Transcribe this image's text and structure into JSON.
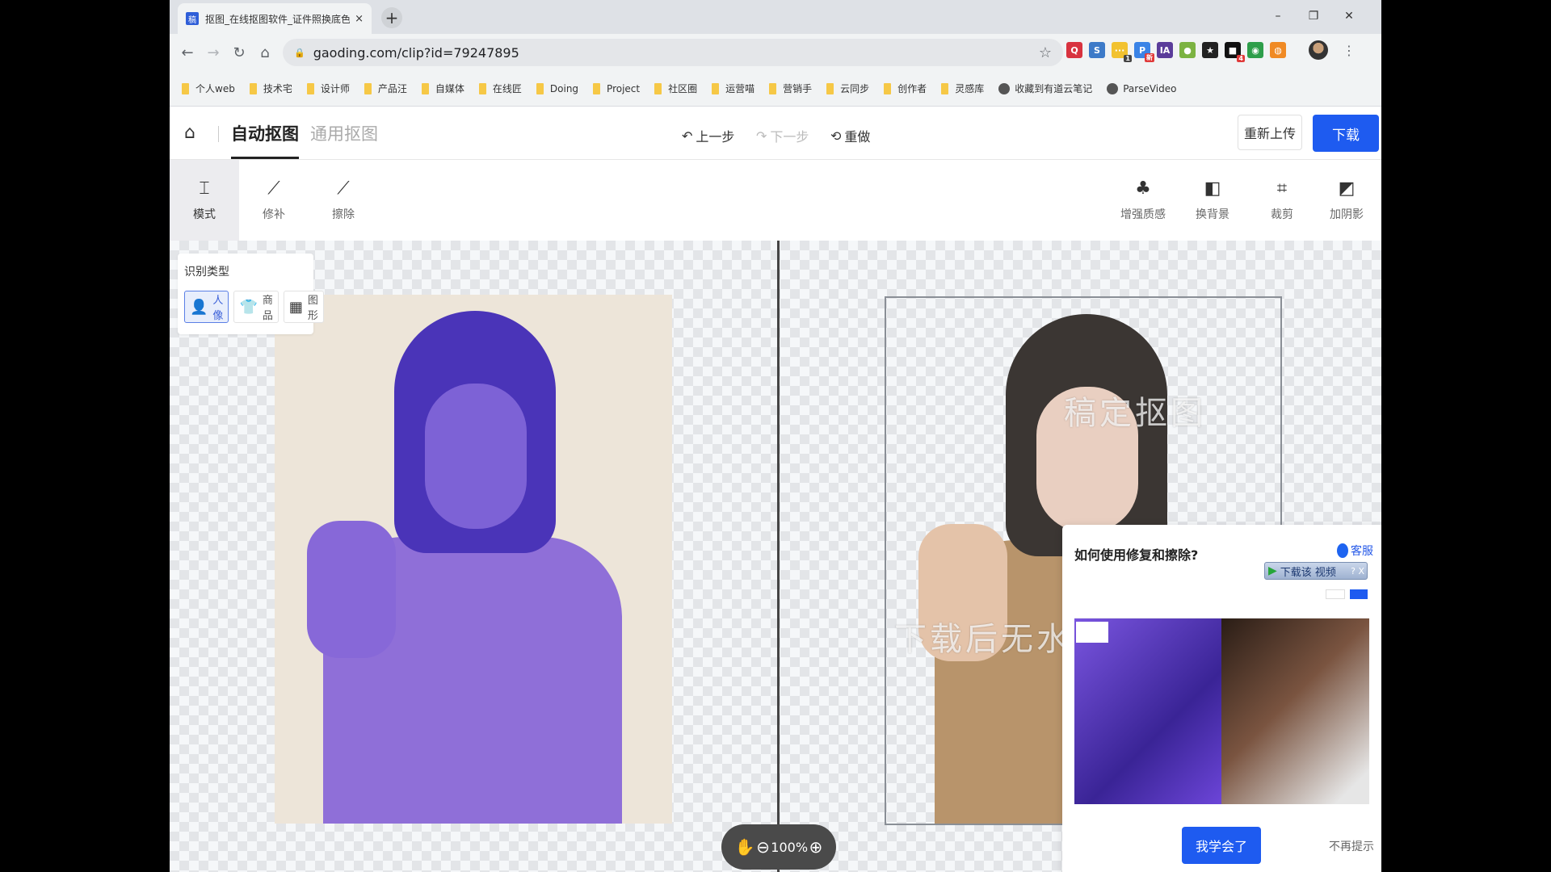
{
  "browser": {
    "tab": {
      "favicon": "稿",
      "title": "抠图_在线抠图软件_证件照换底色",
      "close": "×"
    },
    "new_tab": "+",
    "window_controls": {
      "minimize": "–",
      "restore": "❐",
      "close": "✕"
    },
    "nav": {
      "back": "←",
      "forward": "→",
      "reload": "↻",
      "home": "⌂"
    },
    "url": "gaoding.com/clip?id=79247895",
    "extensions": [
      {
        "name": "search-ext",
        "glyph": "Q",
        "color": "#d8333f",
        "badge": ""
      },
      {
        "name": "s-ext",
        "glyph": "S",
        "color": "#3d7ac8",
        "badge": ""
      },
      {
        "name": "notes-ext",
        "glyph": "···",
        "color": "#f2c230",
        "badge": "1"
      },
      {
        "name": "p-ext",
        "glyph": "P",
        "color": "#3a83e6",
        "badge": "新"
      },
      {
        "name": "ia-ext",
        "glyph": "IA",
        "color": "#5a3c9a",
        "badge": ""
      },
      {
        "name": "green-ext",
        "glyph": "●",
        "color": "#7cb342",
        "badge": ""
      },
      {
        "name": "star-ext",
        "glyph": "★",
        "color": "#222222",
        "badge": ""
      },
      {
        "name": "evernote-ext",
        "glyph": "■",
        "color": "#111111",
        "badge": "4"
      },
      {
        "name": "globe-ext",
        "glyph": "◉",
        "color": "#2e9e4a",
        "badge": ""
      },
      {
        "name": "orange-ext",
        "glyph": "◍",
        "color": "#f08a24",
        "badge": ""
      }
    ],
    "bookmarks": [
      {
        "label": "个人web",
        "type": "folder"
      },
      {
        "label": "技术宅",
        "type": "folder"
      },
      {
        "label": "设计师",
        "type": "folder"
      },
      {
        "label": "产品汪",
        "type": "folder"
      },
      {
        "label": "自媒体",
        "type": "folder"
      },
      {
        "label": "在线匠",
        "type": "folder"
      },
      {
        "label": "Doing",
        "type": "folder"
      },
      {
        "label": "Project",
        "type": "folder"
      },
      {
        "label": "社区圈",
        "type": "folder"
      },
      {
        "label": "运营喵",
        "type": "folder"
      },
      {
        "label": "营销手",
        "type": "folder"
      },
      {
        "label": "云同步",
        "type": "folder"
      },
      {
        "label": "创作者",
        "type": "folder"
      },
      {
        "label": "灵感库",
        "type": "folder"
      },
      {
        "label": "收藏到有道云笔记",
        "type": "link"
      },
      {
        "label": "ParseVideo",
        "type": "link"
      }
    ]
  },
  "header": {
    "home_icon": "⌂",
    "tabs": [
      {
        "label": "自动抠图",
        "active": true
      },
      {
        "label": "通用抠图",
        "active": false
      }
    ],
    "undo": {
      "icon": "↶",
      "label": "上一步"
    },
    "redo": {
      "icon": "↷",
      "label": "下一步"
    },
    "reset": {
      "icon": "⟲",
      "label": "重做"
    },
    "reupload_label": "重新上传",
    "download_label": "下载"
  },
  "tools_left": [
    {
      "label": "模式",
      "icon": "⌶",
      "selected": true
    },
    {
      "label": "修补",
      "icon": "⟋",
      "selected": false
    },
    {
      "label": "擦除",
      "icon": "⟋",
      "selected": false
    }
  ],
  "tools_right": [
    {
      "label": "增强质感",
      "icon": "♣"
    },
    {
      "label": "换背景",
      "icon": "◧"
    },
    {
      "label": "裁剪",
      "icon": "⌗"
    },
    {
      "label": "加阴影",
      "icon": "◩"
    }
  ],
  "recognition": {
    "title": "识别类型",
    "options": [
      {
        "label": "人像",
        "icon": "👤",
        "active": true
      },
      {
        "label": "商品",
        "icon": "👕",
        "active": false
      },
      {
        "label": "图形",
        "icon": "▦",
        "active": false
      }
    ]
  },
  "watermarks": [
    "稿定抠图",
    "下载后无水印"
  ],
  "zoom": {
    "hand": "✋",
    "out": "⊖",
    "level": "100%",
    "in": "⊕"
  },
  "tutorial": {
    "title": "如何使用修复和擦除?",
    "support_label": "客服",
    "download_video_label": "下载该 视频",
    "download_video_extra": "? X",
    "primary_label": "我学会了",
    "secondary_label": "不再提示"
  }
}
